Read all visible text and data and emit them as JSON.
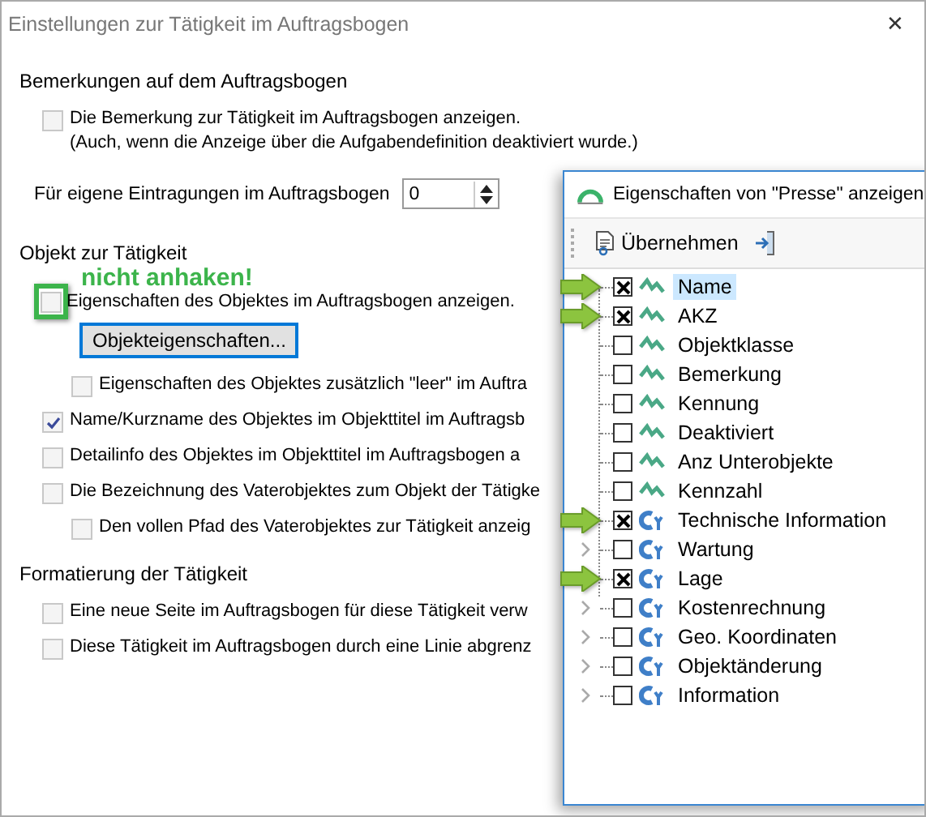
{
  "window": {
    "title": "Einstellungen zur Tätigkeit im Auftragsbogen",
    "close": "✕"
  },
  "sections": [
    {
      "title": "Bemerkungen auf dem Auftragsbogen",
      "items": [
        {
          "kind": "check",
          "label": "Die Bemerkung zur Tätigkeit im Auftragsbogen anzeigen.",
          "note": "(Auch, wenn die Anzeige über die Aufgabendefinition deaktiviert wurde.)",
          "checked": false
        },
        {
          "kind": "spin",
          "label": "Für eigene Eintragungen im Auftragsbogen",
          "value": "0"
        }
      ]
    },
    {
      "title": "Objekt zur Tätigkeit",
      "items": [
        {
          "kind": "check",
          "label": "Eigenschaften des Objektes im Auftragsbogen anzeigen.",
          "checked": false,
          "annotation": "nicht anhaken!"
        },
        {
          "kind": "button",
          "label": "Objekteigenschaften..."
        },
        {
          "kind": "subcheck",
          "label": "Eigenschaften des Objektes zusätzlich \"leer\" im Auftra",
          "checked": false
        },
        {
          "kind": "check",
          "label": "Name/Kurzname des Objektes im Objekttitel im Auftragsb",
          "checked": true
        },
        {
          "kind": "check",
          "label": "Detailinfo des Objektes im Objekttitel im Auftragsbogen a",
          "checked": false
        },
        {
          "kind": "check",
          "label": "Die Bezeichnung des Vaterobjektes zum Objekt der Tätigke",
          "checked": false
        },
        {
          "kind": "subcheck",
          "label": "Den vollen Pfad des Vaterobjektes zur Tätigkeit anzeig",
          "checked": false
        }
      ]
    },
    {
      "title": "Formatierung der Tätigkeit",
      "items": [
        {
          "kind": "check",
          "label": "Eine neue Seite im Auftragsbogen für diese Tätigkeit verw",
          "checked": false
        },
        {
          "kind": "check",
          "label": "Diese Tätigkeit im Auftragsbogen durch eine Linie abgrenz",
          "checked": false
        }
      ]
    }
  ],
  "popup": {
    "title": "Eigenschaften von \"Presse\" anzeigen",
    "apply": "Übernehmen",
    "items": [
      {
        "kind": "field",
        "label": "Name",
        "checked": true,
        "selected": true,
        "marked": true
      },
      {
        "kind": "field",
        "label": "AKZ",
        "checked": true,
        "selected": false,
        "marked": true
      },
      {
        "kind": "field",
        "label": "Objektklasse",
        "checked": false,
        "selected": false,
        "marked": false
      },
      {
        "kind": "field",
        "label": "Bemerkung",
        "checked": false,
        "selected": false,
        "marked": false
      },
      {
        "kind": "field",
        "label": "Kennung",
        "checked": false,
        "selected": false,
        "marked": false
      },
      {
        "kind": "field",
        "label": "Deaktiviert",
        "checked": false,
        "selected": false,
        "marked": false
      },
      {
        "kind": "field",
        "label": "Anz Unterobjekte",
        "checked": false,
        "selected": false,
        "marked": false
      },
      {
        "kind": "field",
        "label": "Kennzahl",
        "checked": false,
        "selected": false,
        "marked": false
      },
      {
        "kind": "group",
        "label": "Technische Information",
        "checked": true,
        "selected": false,
        "marked": true
      },
      {
        "kind": "group",
        "label": "Wartung",
        "checked": false,
        "selected": false,
        "marked": false,
        "expanded": false
      },
      {
        "kind": "group",
        "label": "Lage",
        "checked": true,
        "selected": false,
        "marked": true
      },
      {
        "kind": "group",
        "label": "Kostenrechnung",
        "checked": false,
        "selected": false,
        "marked": false,
        "expanded": false
      },
      {
        "kind": "group",
        "label": "Geo. Koordinaten",
        "checked": false,
        "selected": false,
        "marked": false,
        "expanded": false
      },
      {
        "kind": "group",
        "label": "Objektänderung",
        "checked": false,
        "selected": false,
        "marked": false,
        "expanded": false
      },
      {
        "kind": "group",
        "label": "Information",
        "checked": false,
        "selected": false,
        "marked": false,
        "expanded": false
      }
    ]
  }
}
